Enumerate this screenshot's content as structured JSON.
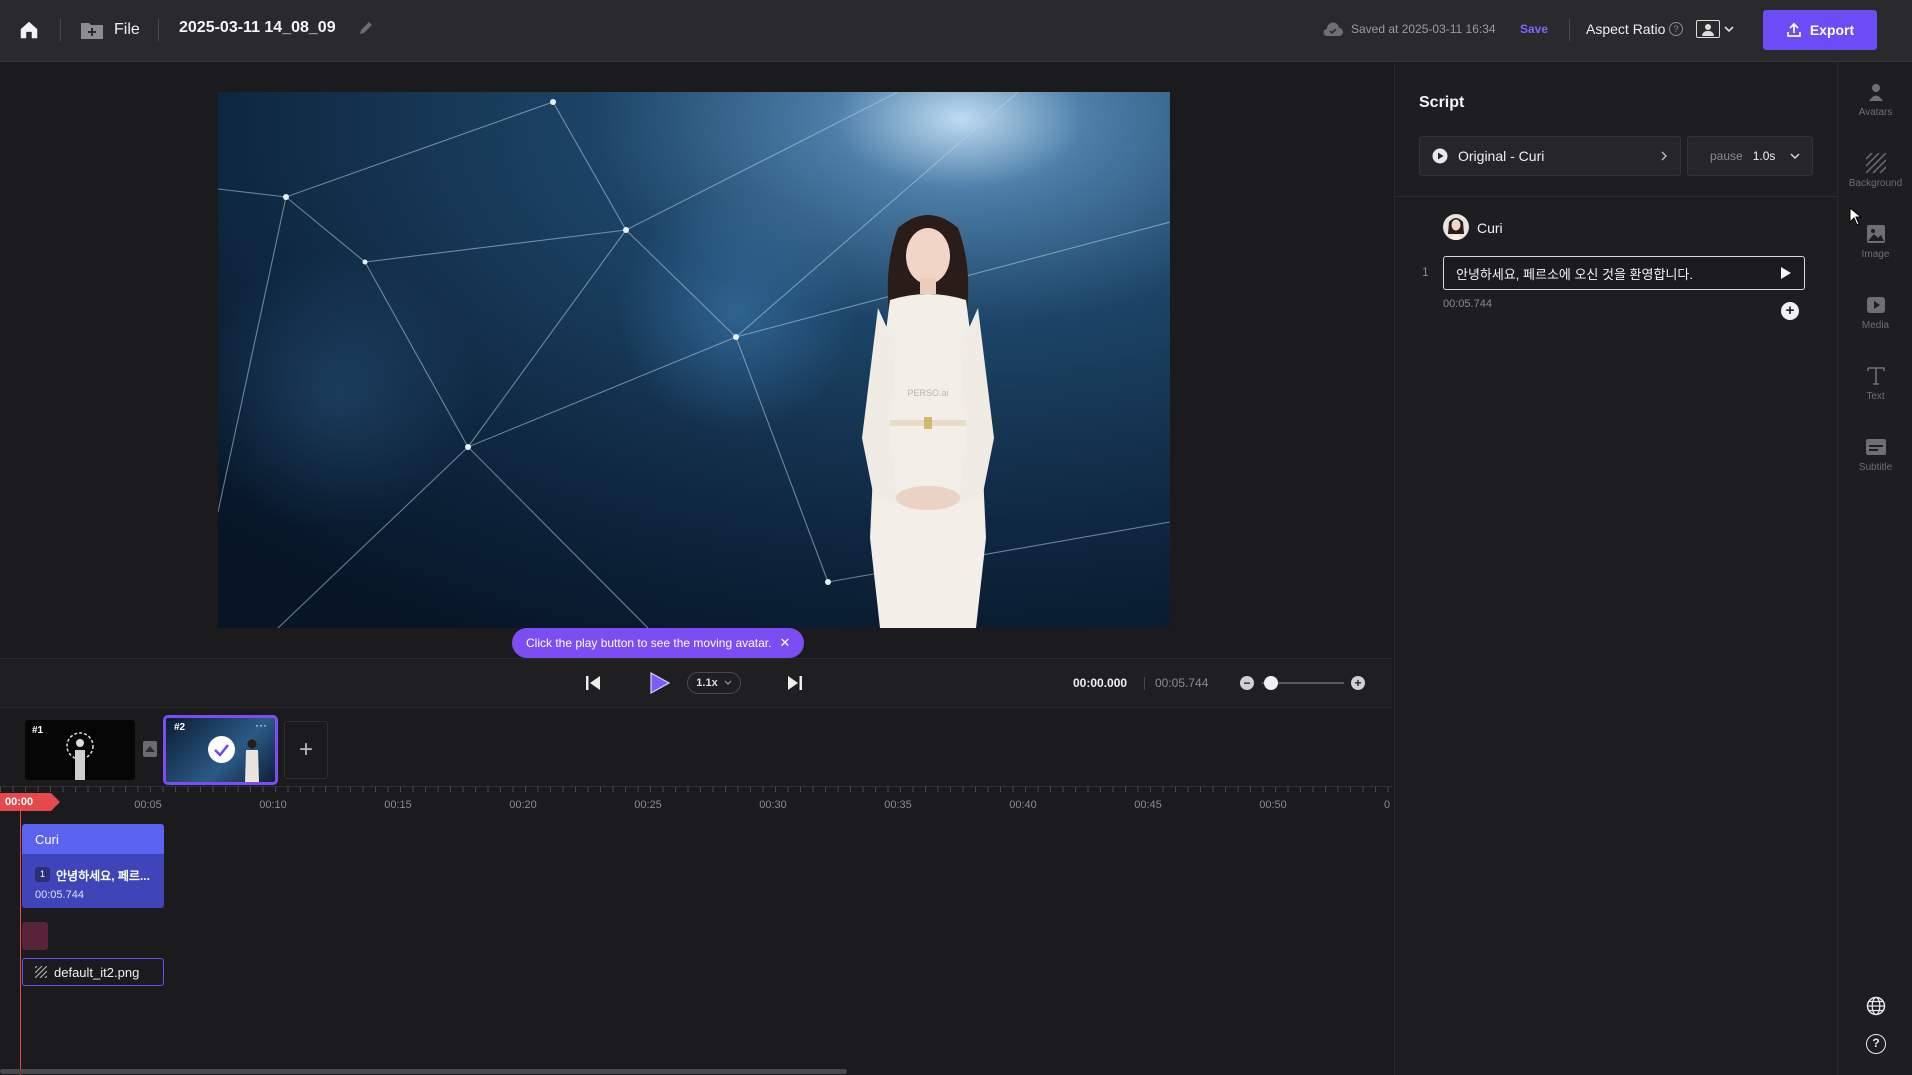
{
  "header": {
    "file_label": "File",
    "project_title": "2025-03-11 14_08_09",
    "saved_status": "Saved at 2025-03-11 16:34",
    "save_label": "Save",
    "aspect_ratio_label": "Aspect Ratio",
    "export_label": "Export"
  },
  "stage": {
    "watermark": "PERSO.ai",
    "tooltip": "Click the play button to see the moving avatar."
  },
  "player": {
    "speed": "1.1x",
    "current_time": "00:00.000",
    "total_time": "00:05.744",
    "zoom_level": 0.05
  },
  "scenes": [
    {
      "badge": "#1"
    },
    {
      "badge": "#2"
    }
  ],
  "timeline": {
    "playhead": "00:00",
    "ticks": [
      "00:05",
      "00:10",
      "00:15",
      "00:20",
      "00:25",
      "00:30",
      "00:35",
      "00:40",
      "00:45",
      "00:50",
      "0"
    ],
    "avatar_track": "Curi",
    "clip_index": "1",
    "clip_text": "안녕하세요, 페르...",
    "clip_duration": "00:05.744",
    "bg_track": "default_it2.png"
  },
  "script": {
    "title": "Script",
    "voice": "Original - Curi",
    "pause_label": "pause",
    "pause_value": "1.0s",
    "speaker": "Curi",
    "line_number": "1",
    "line_text": "안녕하세요, 페르소에 오신 것을 환영합니다.",
    "line_duration": "00:05.744"
  },
  "rail": {
    "avatars": "Avatars",
    "background": "Background",
    "image": "Image",
    "media": "Media",
    "text": "Text",
    "subtitle": "Subtitle"
  },
  "colors": {
    "accent": "#6b4cf6",
    "save_link": "#7b68ff",
    "playhead": "#e5484d",
    "clip_blue": "#5b64f0",
    "tooltip": "#7c4df2"
  }
}
